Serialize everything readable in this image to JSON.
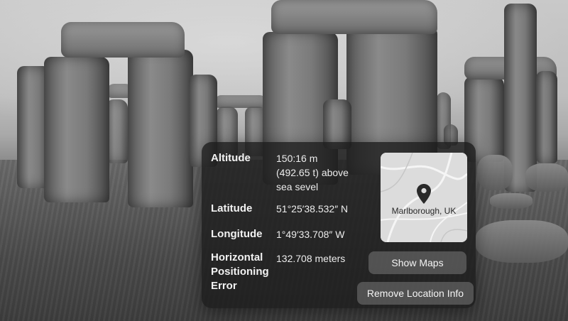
{
  "location_info": {
    "altitude": {
      "label": "Altitude",
      "line1": "150:16 m",
      "line2": "(492.65 t) above",
      "line3": "sea sevel"
    },
    "latitude": {
      "label": "Latitude",
      "value": "51°25′38.532″ N"
    },
    "longitude": {
      "label": "Longitude",
      "value": "1°49′33.708″ W"
    },
    "horizontal_error": {
      "label_line1": "Horizontal",
      "label_line2": "Positioning",
      "label_line3": "Error",
      "value": "132.708 meters"
    },
    "map": {
      "place": "Marlborough, UK",
      "pin_icon": "map-pin-icon"
    },
    "buttons": {
      "show_maps": "Show Maps",
      "remove_location": "Remove Location Info"
    }
  }
}
